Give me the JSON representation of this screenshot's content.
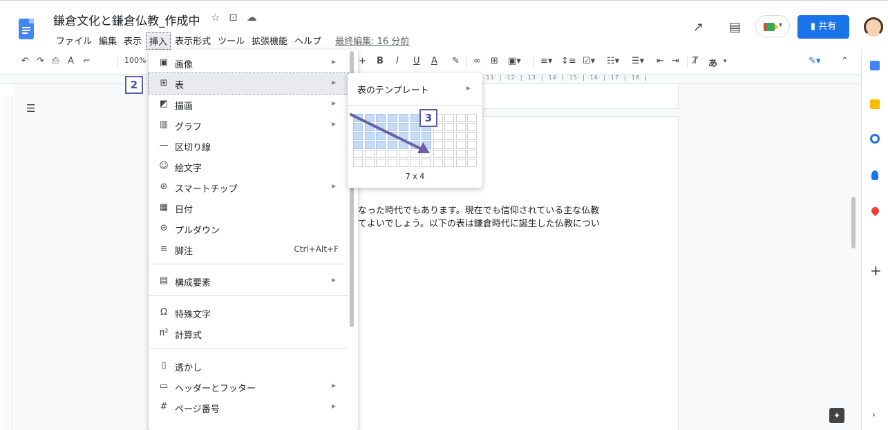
{
  "header": {
    "doc_title": "鎌倉文化と鎌倉仏教_作成中",
    "title_icons": [
      "star-icon",
      "folder-icon",
      "cloud-icon"
    ],
    "menus": [
      "ファイル",
      "編集",
      "表示",
      "挿入",
      "表示形式",
      "ツール",
      "拡張機能",
      "ヘルプ"
    ],
    "last_edit": "最終編集: 16 分前",
    "share_label": "共有"
  },
  "toolbar": {
    "zoom": "100%",
    "font_size_plus": "+",
    "bold": "B",
    "italic": "I",
    "underline": "U",
    "text_color": "A",
    "input_mode": "あ"
  },
  "ruler_numbers": "·11· | ·12· | ·13· | ·14· | ·15· | ·16· | ·17· | ·18· |",
  "document": {
    "body_lines": [
      "なった時代でもあります。現在でも信仰されている主な仏教",
      "てよいでしょう。以下の表は鎌倉時代に誕生した仏教につい"
    ]
  },
  "insert_menu": {
    "items": [
      {
        "icon": "image-icon",
        "label": "画像",
        "submenu": true
      },
      {
        "icon": "table-icon",
        "label": "表",
        "submenu": true,
        "highlighted": true
      },
      {
        "icon": "drawing-icon",
        "label": "描画",
        "submenu": true
      },
      {
        "icon": "chart-icon",
        "label": "グラフ",
        "submenu": true
      },
      {
        "icon": "horizontal-line-icon",
        "label": "区切り線",
        "submenu": false
      },
      {
        "icon": "emoji-icon",
        "label": "絵文字",
        "submenu": false
      },
      {
        "icon": "smart-chip-icon",
        "label": "スマートチップ",
        "submenu": true
      },
      {
        "icon": "calendar-icon",
        "label": "日付",
        "submenu": false
      },
      {
        "icon": "dropdown-icon",
        "label": "プルダウン",
        "submenu": false
      },
      {
        "icon": "footnote-icon",
        "label": "脚注",
        "shortcut": "Ctrl+Alt+F",
        "submenu": false
      },
      {
        "icon": "building-blocks-icon",
        "label": "構成要素",
        "submenu": true
      },
      {
        "icon": "omega-icon",
        "label": "特殊文字",
        "submenu": false
      },
      {
        "icon": "equation-icon",
        "label": "計算式",
        "submenu": false
      },
      {
        "icon": "watermark-icon",
        "label": "透かし",
        "submenu": false
      },
      {
        "icon": "header-footer-icon",
        "label": "ヘッダーとフッター",
        "submenu": true
      },
      {
        "icon": "hash-icon",
        "label": "ページ番号",
        "submenu": true
      }
    ]
  },
  "table_submenu": {
    "template_label": "表のテンプレート",
    "grid_size": "7 x 4",
    "selected_cols": 7,
    "selected_rows": 4,
    "grid_cols": 11,
    "grid_rows": 6
  },
  "badges": {
    "step2": "2",
    "step3": "3"
  },
  "colors": {
    "accent": "#1a73e8",
    "badge": "#5b5fa3",
    "grid_selected": "#c6dbf5"
  }
}
